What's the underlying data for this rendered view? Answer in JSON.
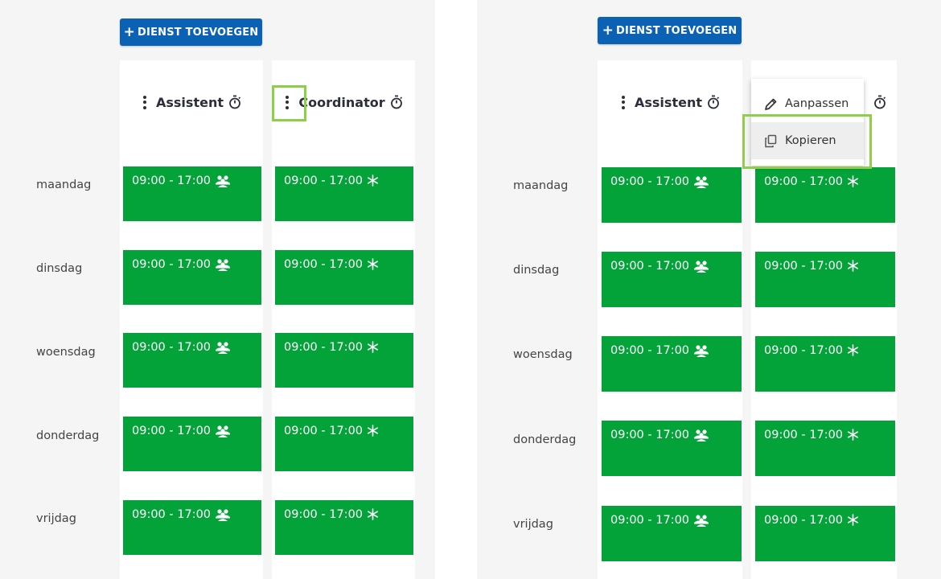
{
  "add_button_label": "DIENST TOEVOEGEN",
  "roles": [
    {
      "name": "Assistent",
      "shift_icon": "people-icon"
    },
    {
      "name": "Coordinator",
      "shift_icon": "asterisk-icon"
    }
  ],
  "days": [
    "maandag",
    "dinsdag",
    "woensdag",
    "donderdag",
    "vrijdag"
  ],
  "shift_time": "09:00 - 17:00",
  "context_menu": {
    "items": [
      {
        "label": "Aanpassen",
        "icon": "pencil-icon"
      },
      {
        "label": "Kopieren",
        "icon": "copy-icon"
      }
    ],
    "active_item": "Kopieren"
  },
  "colors": {
    "background": "#f5f5f5",
    "button": "#0b62b5",
    "shift": "#04a33a",
    "highlight": "#8fce4a",
    "text": "#2b2f3a"
  }
}
